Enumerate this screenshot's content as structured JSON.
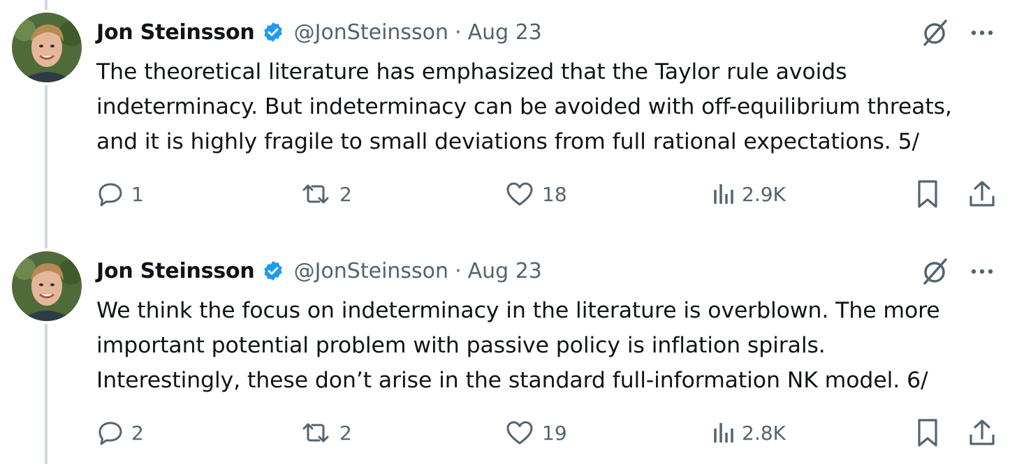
{
  "tweets": [
    {
      "author_name": "Jon Steinsson",
      "handle": "@JonSteinsson",
      "separator": "·",
      "date": "Aug 23",
      "text_lines": [
        "The theoretical literature has emphasized that the Taylor rule avoids",
        "indeterminacy. But indeterminacy can be avoided with off-equilibrium threats,",
        "and it is highly fragile to small deviations from full rational expectations. 5/"
      ],
      "replies": "1",
      "reposts": "2",
      "likes": "18",
      "views": "2.9K"
    },
    {
      "author_name": "Jon Steinsson",
      "handle": "@JonSteinsson",
      "separator": "·",
      "date": "Aug 23",
      "text_lines": [
        "We think the focus on indeterminacy in the literature is overblown. The more",
        "important potential problem with passive policy is inflation spirals.",
        "Interestingly, these don’t arise in the standard full-information NK model. 6/"
      ],
      "replies": "2",
      "reposts": "2",
      "likes": "19",
      "views": "2.8K"
    }
  ],
  "icons": {
    "verified": "verified-badge-icon",
    "grok": "grok-icon",
    "more": "more-icon",
    "reply": "reply-icon",
    "repost": "repost-icon",
    "like": "like-icon",
    "views": "views-icon",
    "bookmark": "bookmark-icon",
    "share": "share-icon"
  },
  "colors": {
    "text": "#0f1419",
    "secondary": "#536471",
    "verified": "#1d9bf0",
    "thread_line": "#cfd9de"
  }
}
